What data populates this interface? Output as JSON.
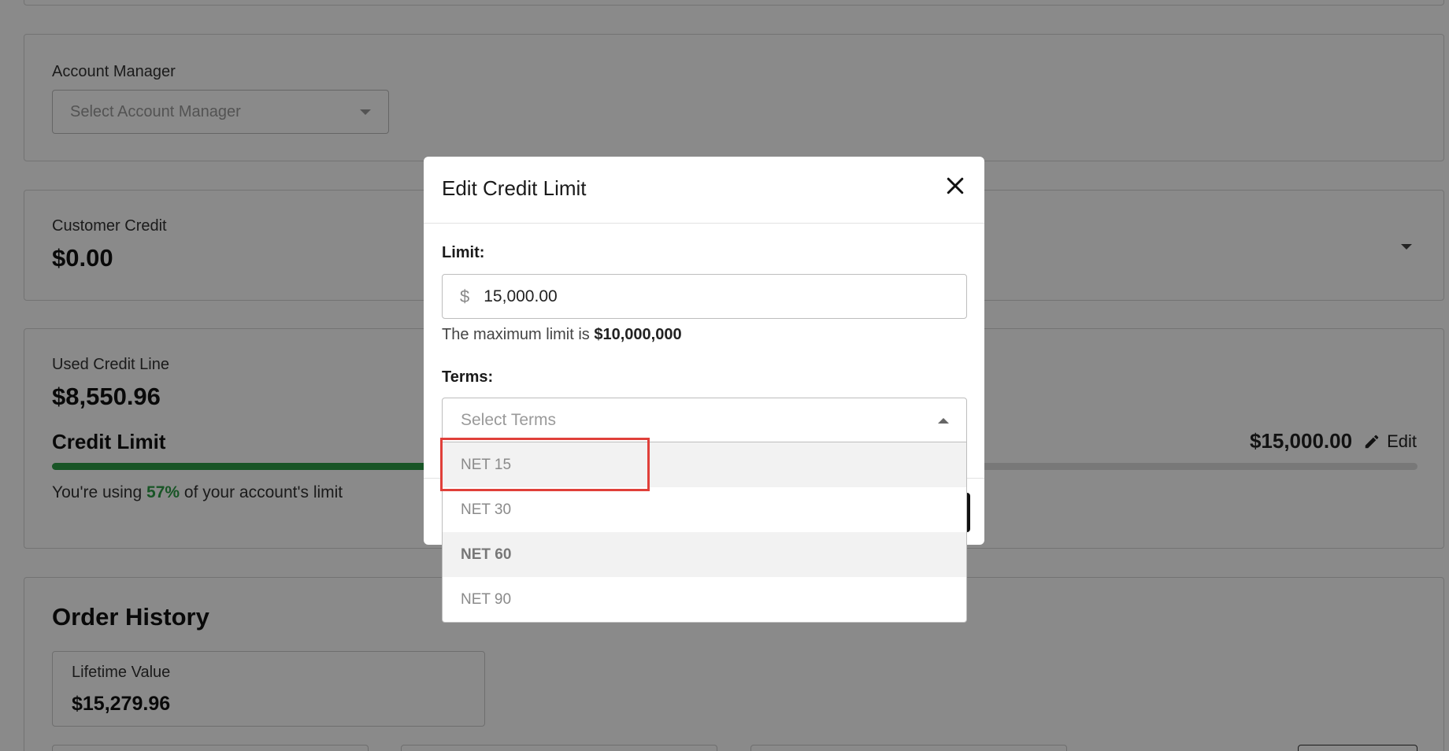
{
  "account_manager": {
    "label": "Account Manager",
    "placeholder": "Select Account Manager"
  },
  "customer_credit": {
    "label": "Customer Credit",
    "value": "$0.00"
  },
  "used_credit": {
    "label": "Used Credit Line",
    "value": "$8,550.96",
    "credit_limit_label": "Credit Limit",
    "credit_limit_value": "$15,000.00",
    "edit_label": "Edit",
    "usage_prefix": "You're using",
    "usage_pct": "57%",
    "usage_suffix": "of your account's limit",
    "progress": 0.57,
    "progress_color": "#2e9e46"
  },
  "order_history": {
    "title": "Order History",
    "lifetime_label": "Lifetime Value",
    "lifetime_value": "$15,279.96"
  },
  "modal": {
    "title": "Edit Credit Limit",
    "limit_label": "Limit:",
    "currency_symbol": "$",
    "limit_value": "15,000.00",
    "hint_prefix": "The maximum limit is",
    "hint_max": "$10,000,000",
    "terms_label": "Terms:",
    "terms_placeholder": "Select Terms",
    "terms_options": [
      "NET 15",
      "NET 30",
      "NET 60",
      "NET 90"
    ]
  },
  "colors": {
    "accent_green": "#2e9e46",
    "highlight_red": "#e0403a"
  }
}
